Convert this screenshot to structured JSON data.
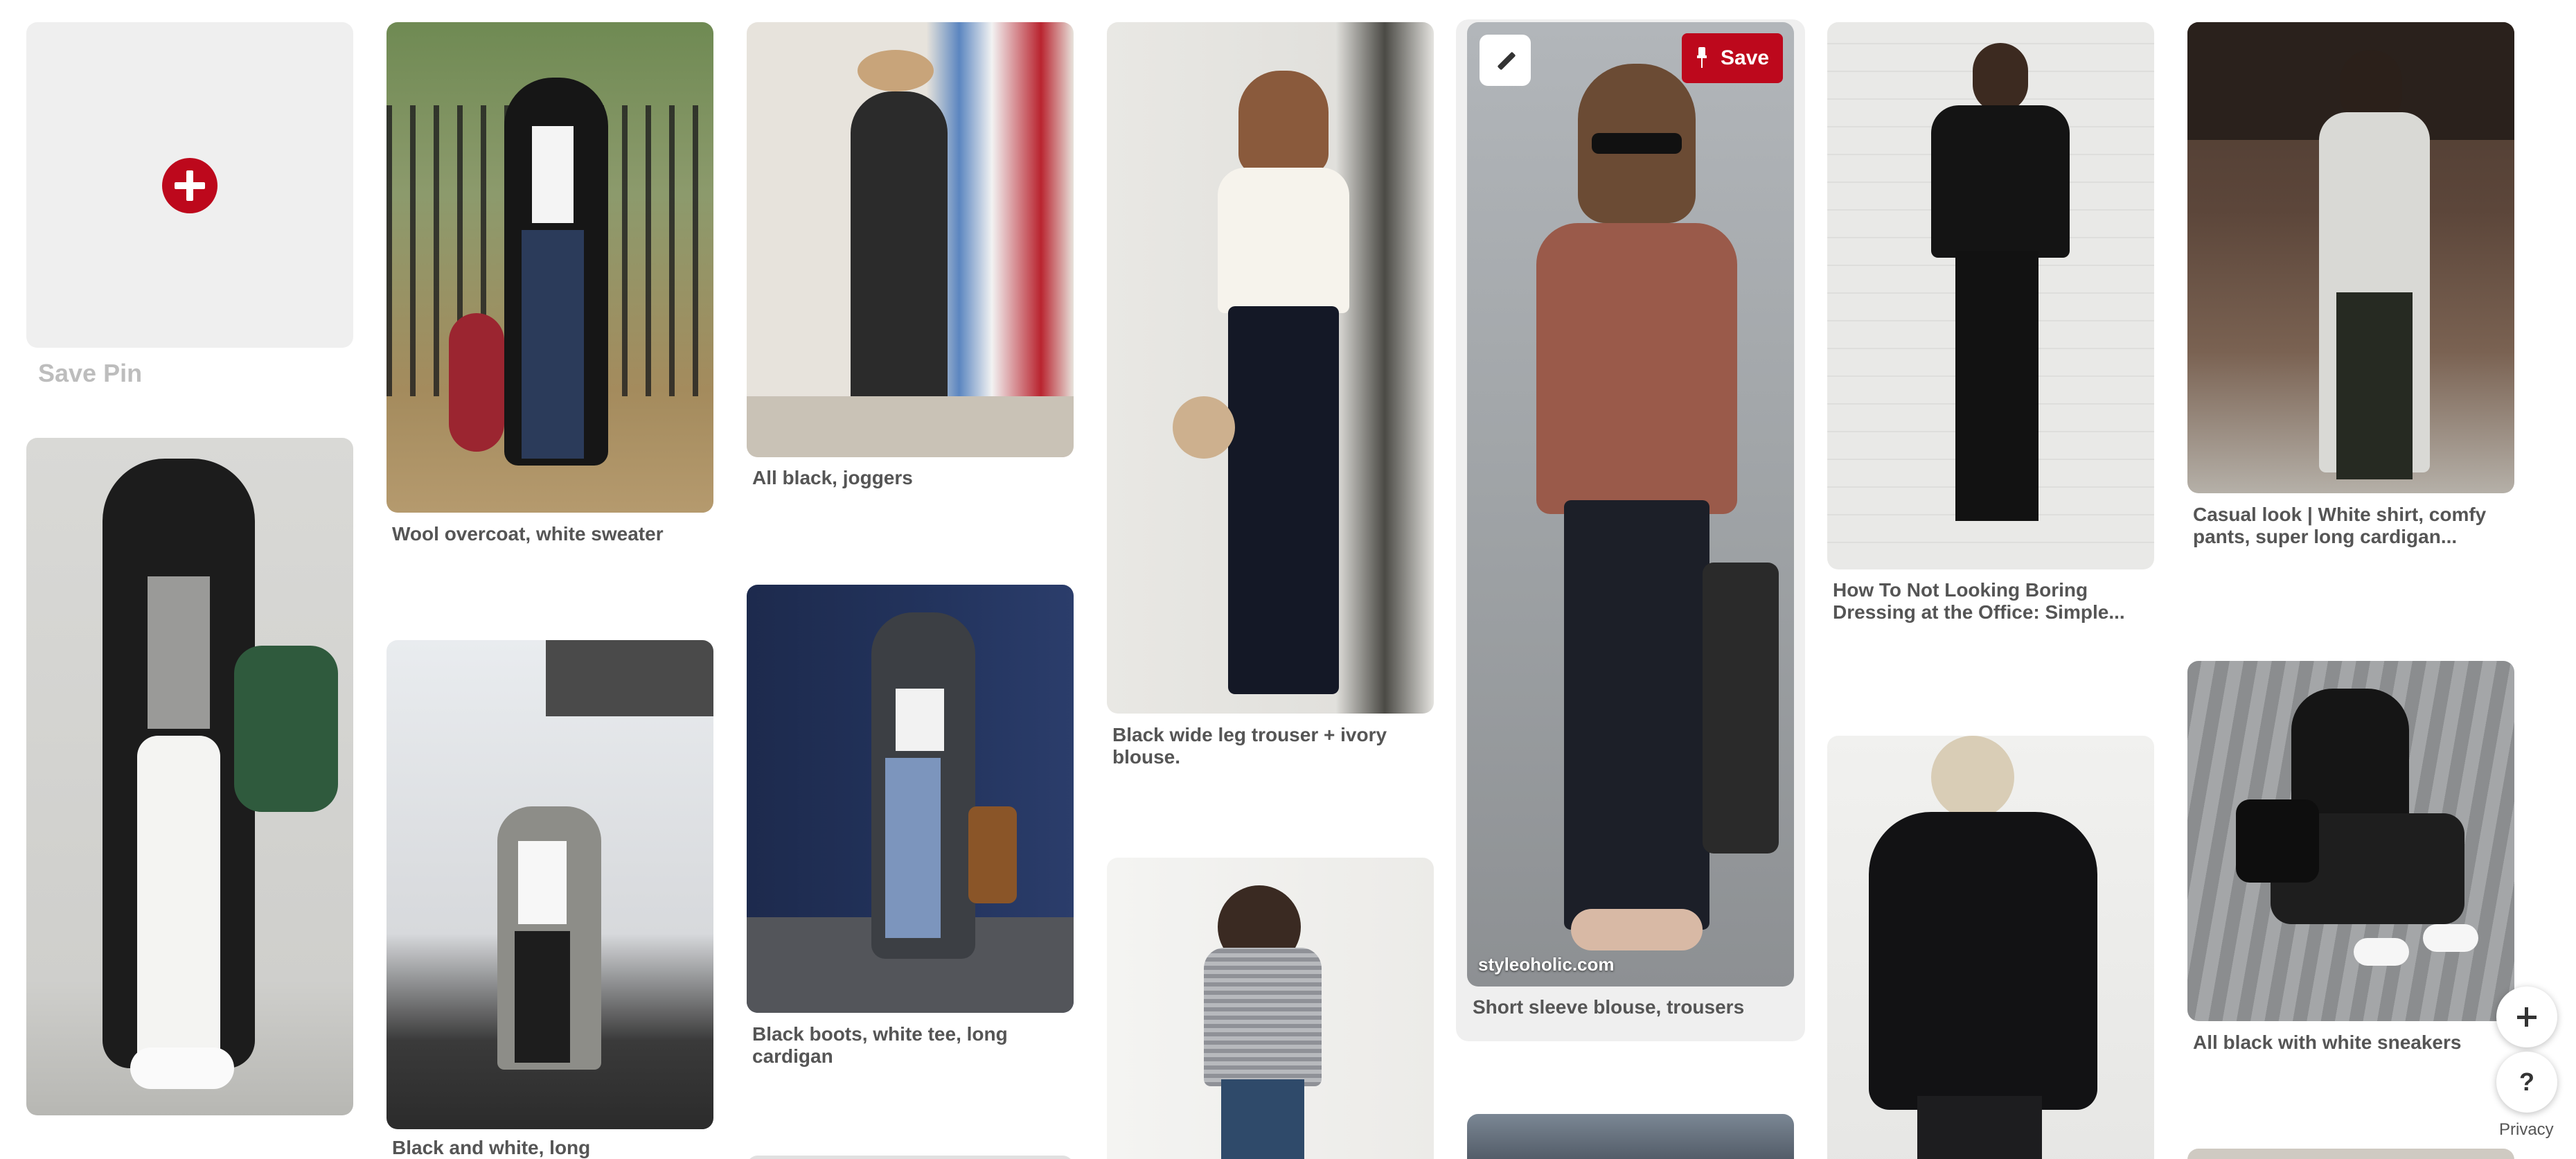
{
  "save_pin": {
    "label": "Save Pin"
  },
  "pins": [
    {
      "caption": "Wool overcoat, white sweater"
    },
    {
      "caption": "All black, joggers"
    },
    {
      "caption": "Black wide leg trouser + ivory blouse."
    },
    {
      "caption": "Short sleeve blouse, trousers",
      "source": "styleoholic.com"
    },
    {
      "caption": "How To Not Looking Boring Dressing at the Office: Simple..."
    },
    {
      "caption": "Casual look | White shirt, comfy pants, super long cardigan..."
    },
    {
      "caption": "Black boots, white tee, long cardigan"
    },
    {
      "caption": "Black and white, long"
    },
    {
      "caption": "All black with white sneakers"
    }
  ],
  "hover_pin": {
    "save_label": "Save"
  },
  "controls": {
    "help": "?",
    "privacy": "Privacy"
  },
  "colors": {
    "brand_red": "#bd081c",
    "tile_gray": "#efefef"
  }
}
